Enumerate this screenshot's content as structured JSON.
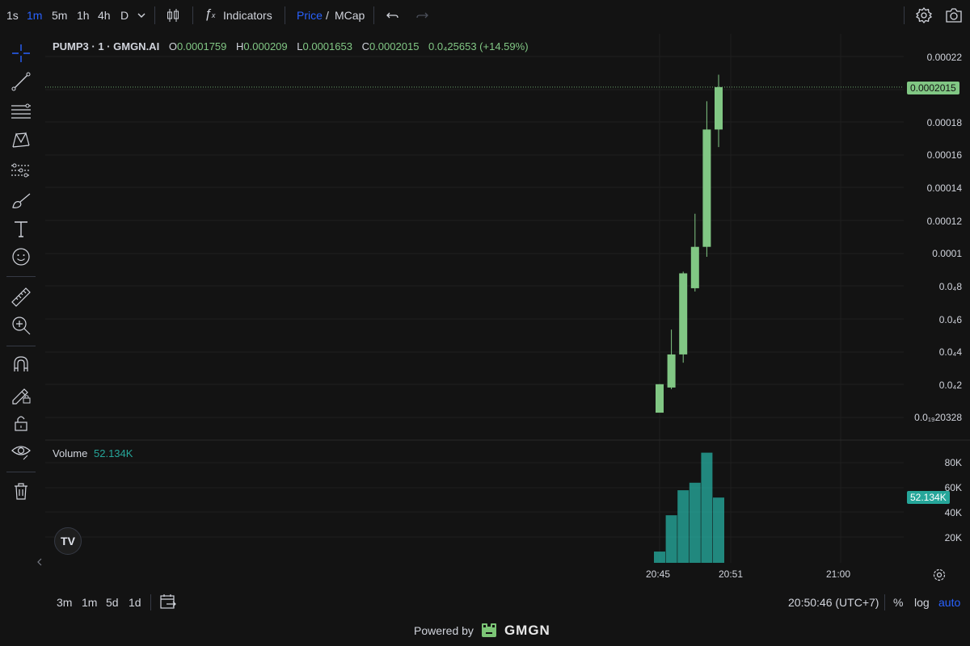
{
  "toolbar": {
    "timeframes": [
      "1s",
      "1m",
      "5m",
      "1h",
      "4h",
      "D"
    ],
    "active_timeframe": "1m",
    "indicators_label": "Indicators",
    "price_label": "Price",
    "slash": "/",
    "mcap_label": "MCap"
  },
  "legend": {
    "symbol": "PUMP3 · 1 · GMGN.AI",
    "o_key": "O",
    "o_val": "0.0001759",
    "h_key": "H",
    "h_val": "0.000209",
    "l_key": "L",
    "l_val": "0.0001653",
    "c_key": "C",
    "c_val": "0.0002015",
    "change": "0.0₄25653 (+14.59%)"
  },
  "volume_legend": {
    "label": "Volume",
    "value": "52.134K"
  },
  "price_axis": [
    "0.00022",
    "0.00018",
    "0.00016",
    "0.00014",
    "0.00012",
    "0.0001",
    "0.0₄8",
    "0.0₄6",
    "0.0₄4",
    "0.0₄2",
    "0.0₁₉20328"
  ],
  "price_tag": "0.0002015",
  "volume_axis": [
    "80K",
    "60K",
    "40K",
    "20K"
  ],
  "volume_tag": "52.134K",
  "time_axis": [
    "20:45",
    "20:51",
    "21:00"
  ],
  "colors": {
    "up": "#81c784",
    "volume": "#26a69a",
    "accent": "#2962ff",
    "background": "#131313"
  },
  "chart_data": {
    "type": "candlestick",
    "candles": [
      {
        "t": "20:45",
        "open": 4.8e-06,
        "high": 2.2e-05,
        "low": 4.8e-06,
        "close": 2.2e-05,
        "volume": 9000
      },
      {
        "t": "20:46",
        "open": 2e-05,
        "high": 5.5e-05,
        "low": 1.9e-05,
        "close": 4e-05,
        "volume": 38000
      },
      {
        "t": "20:47",
        "open": 4e-05,
        "high": 9e-05,
        "low": 3.5e-05,
        "close": 8.9e-05,
        "volume": 58000
      },
      {
        "t": "20:48",
        "open": 8e-05,
        "high": 0.000125,
        "low": 7.8e-05,
        "close": 0.000105,
        "volume": 64000
      },
      {
        "t": "20:49",
        "open": 0.000105,
        "high": 0.000193,
        "low": 9.9e-05,
        "close": 0.0001759,
        "volume": 88000
      },
      {
        "t": "20:50",
        "open": 0.0001759,
        "high": 0.000209,
        "low": 0.0001653,
        "close": 0.0002015,
        "volume": 52134
      }
    ],
    "price_range": [
      1.9e-06,
      0.00022
    ],
    "volume_range": [
      0,
      80000
    ]
  },
  "bottom": {
    "ranges": [
      "3m",
      "1m",
      "5d",
      "1d"
    ],
    "clock": "20:50:46 (UTC+7)",
    "percent": "%",
    "log": "log",
    "auto": "auto",
    "powered_by": "Powered by",
    "brand": "GMGN"
  }
}
